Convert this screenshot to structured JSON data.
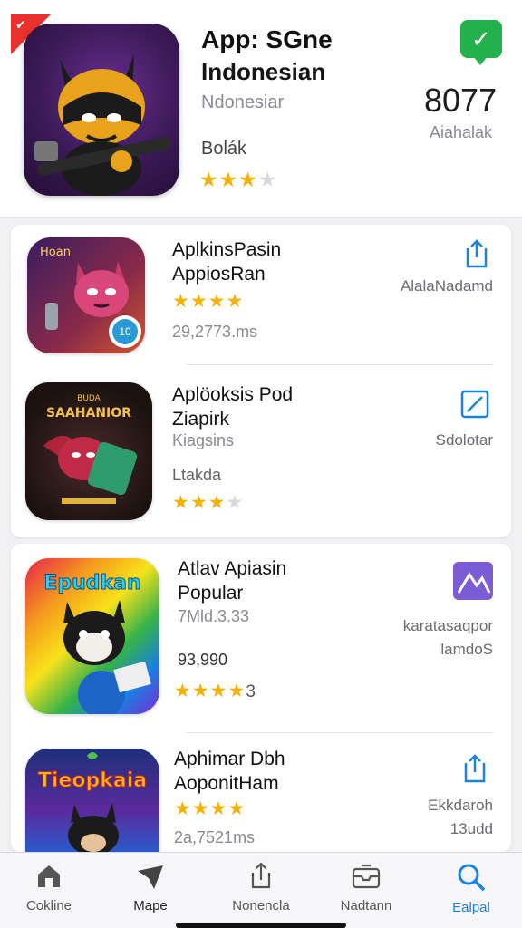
{
  "hero": {
    "badge": "✔",
    "title": "App: SGne",
    "subtitle": "Indonesian",
    "subtitle2": "Ndonesiar",
    "label": "Bolák",
    "rating_stars": "★★★",
    "rating_empty": "★",
    "count": "8077",
    "count_label": "Aiahalak",
    "colors": {
      "check": "#22b14c",
      "badge": "#e8322b",
      "stars": "#f2b20b"
    }
  },
  "apps": [
    {
      "name_line1": "AplkinsPasin",
      "name_line2": "AppiosRan",
      "stars": "★★★★",
      "stars_empty": "",
      "size": "29,2773.ms",
      "side_text": "AlalaNadamd",
      "icon_badge": "10",
      "action_icon": "share-icon"
    },
    {
      "name_line1": "Aplöoksis Pod",
      "name_line2": "Ziapirk",
      "size": "Kiagsins",
      "extra": "Ltakda",
      "stars": "★★★",
      "stars_empty": "★",
      "side_text": "Sdolotar",
      "icon_text": "SAAHANIOR",
      "action_icon": "edit-icon"
    },
    {
      "name_line1": "Atlav Apiasin",
      "name_line2": "Popular",
      "size": "7Mld.3.33",
      "extra": "93,990",
      "stars": "★★★★",
      "stars_empty": "",
      "rating_num": "3",
      "side_text_line1": "karatasaqpor",
      "side_text_line2": "lamdoS",
      "icon_text": "Epudkan",
      "action_icon": "chart-icon"
    },
    {
      "name_line1": "Aphimar Dbh",
      "name_line2": "AoponitHam",
      "stars": "★★★★",
      "stars_empty": "",
      "size": "2a,7521ms",
      "side_text_line1": "Ekkdaroh",
      "side_text_line2": "13udd",
      "icon_text": "Tieopkaia",
      "action_icon": "share-icon"
    }
  ],
  "tabs": [
    {
      "label": "Cokline",
      "icon": "home-icon"
    },
    {
      "label": "Mape",
      "icon": "paper-plane-icon"
    },
    {
      "label": "Nonencla",
      "icon": "share-icon"
    },
    {
      "label": "Nadtann",
      "icon": "inbox-icon"
    },
    {
      "label": "Ealpal",
      "icon": "search-icon",
      "active": true
    }
  ],
  "accent": "#1b82e0"
}
